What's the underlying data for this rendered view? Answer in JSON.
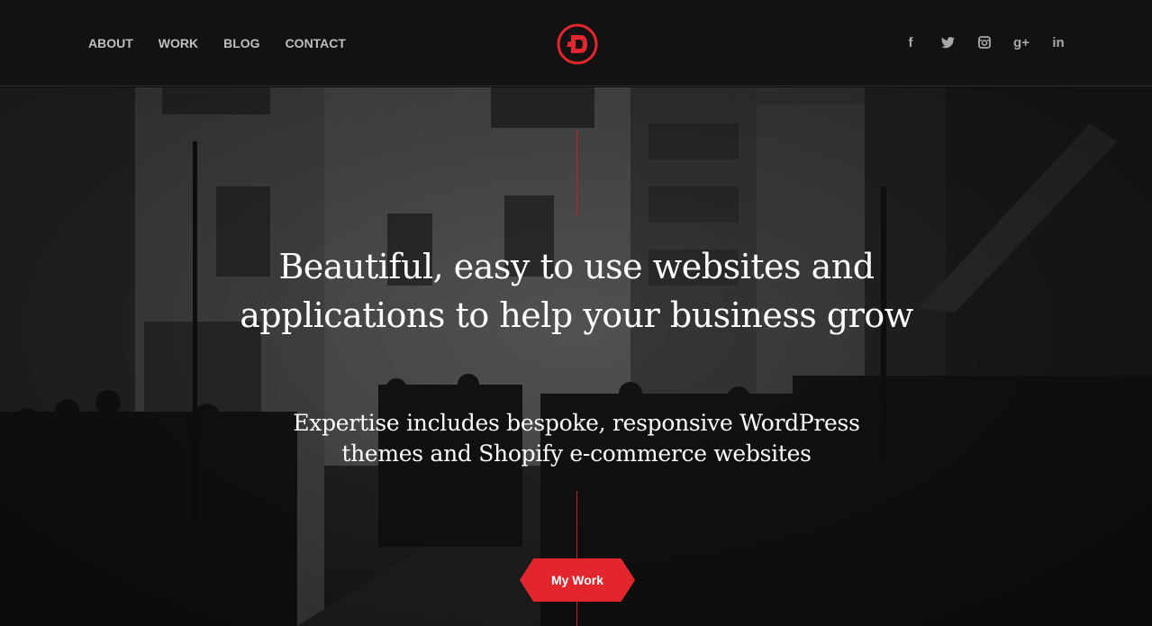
{
  "nav": {
    "items": [
      {
        "label": "ABOUT"
      },
      {
        "label": "WORK"
      },
      {
        "label": "BLOG"
      },
      {
        "label": "CONTACT"
      }
    ]
  },
  "logo": {
    "letter": "D",
    "color": "#e3262e"
  },
  "social": [
    {
      "icon": "facebook-icon",
      "glyph": "f"
    },
    {
      "icon": "twitter-icon"
    },
    {
      "icon": "instagram-icon"
    },
    {
      "icon": "google-plus-icon",
      "glyph": "g+"
    },
    {
      "icon": "linkedin-icon",
      "glyph": "in"
    }
  ],
  "hero": {
    "headline": "Beautiful, easy to use websites and applications to help your business grow",
    "subheadline": "Expertise includes bespoke, responsive WordPress themes and Shopify e-commerce websites",
    "cta_label": "My Work"
  },
  "colors": {
    "accent": "#e3262e",
    "header_bg": "#121212",
    "text": "#ffffff"
  }
}
